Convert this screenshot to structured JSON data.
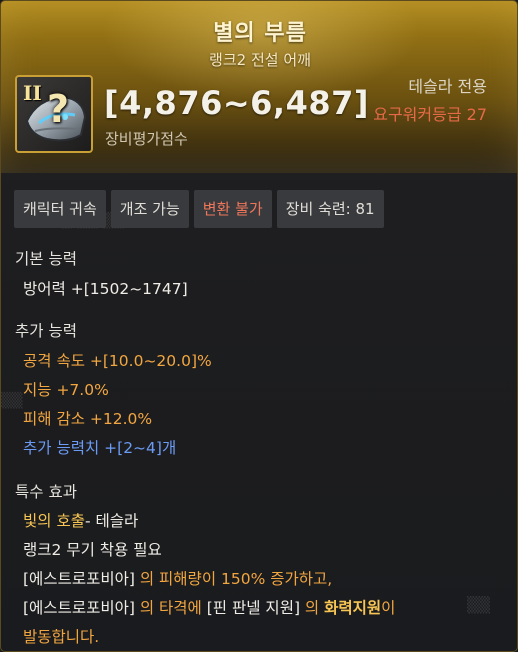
{
  "item": {
    "name": "별의 부름",
    "subtitle": "랭크2 전설 어깨",
    "rank_numeral": "II",
    "icon_mark": "?",
    "icon": "shoulder-armor-icon",
    "score": "[4,876~6,487]",
    "score_label": "장비평가점수",
    "class_requirement": "테슬라 전용",
    "level_requirement": "요구워커등급 27"
  },
  "tags": [
    "캐릭터 귀속",
    "개조 가능",
    "변환 불가",
    "장비 숙련: 81"
  ],
  "basic": {
    "header": "기본 능력",
    "lines": [
      "방어력  +[1502~1747]"
    ]
  },
  "additional": {
    "header": "추가 능력",
    "lines": [
      "공격 속도  +[10.0~20.0]%",
      "지능  +7.0%",
      "피해 감소  +12.0%",
      "추가 능력치 +[2~4]개"
    ]
  },
  "special": {
    "header": "특수 효과",
    "skill_name": "빛의 호출",
    "skill_owner": "- 테슬라",
    "requirement": "랭크2 무기 착용 필요",
    "effect1_part1": "[에스트로포비아]",
    "effect1_part2": " 의 피해량이 150% 증가하고,",
    "effect2_part1": "[에스트로포비아]",
    "effect2_part2": " 의 타격에 ",
    "effect2_part3": "[핀 판넬 지원]",
    "effect2_part4": " 의 ",
    "effect2_part5": "화력지원",
    "effect2_part6": "이",
    "effect3": "발동합니다."
  },
  "colors": {
    "gold_header": "#b08a1e",
    "rare_red": "#e66a47",
    "option_orange": "#f2a640",
    "option_blue": "#6b9bf5",
    "skill_gold": "#f7c553"
  }
}
